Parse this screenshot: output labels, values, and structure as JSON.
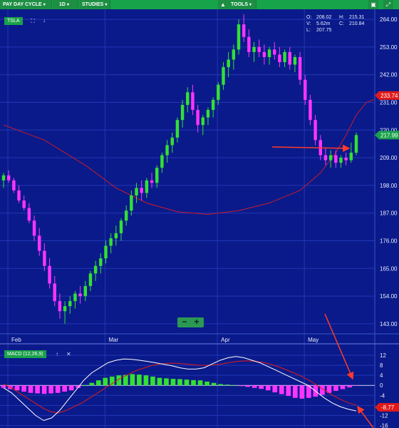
{
  "toolbar": {
    "pay_day_cycle": "PAY DAY CYCLE",
    "interval": "1D",
    "studies": "STUDIES",
    "tools": "TOOLS"
  },
  "ticker": "TSLA",
  "macd_label": "MACD (12,26,9)",
  "ohlc": {
    "o_label": "O:",
    "o": "208.02",
    "h_label": "H:",
    "h": "215.31",
    "v_label": "V:",
    "v": "5.62m",
    "c_label": "C:",
    "c": "210.84",
    "l_label": "L:",
    "l": "207.75"
  },
  "colors": {
    "background": "#0a1a8a",
    "up": "#33e033",
    "down": "#ff33ff",
    "ma": "#cc1a2a",
    "macd_signal": "#e01a1a",
    "macd_line": "#ffffff",
    "arrow": "#ff3a2a",
    "toolbar": "#17a34a"
  },
  "chart_data": [
    {
      "type": "candlestick",
      "title": "TSLA",
      "x_labels": [
        "Feb",
        "Mar",
        "Apr",
        "May"
      ],
      "yticks": [
        "264.00",
        "253.00",
        "242.00",
        "231.00",
        "220.00",
        "209.00",
        "198.00",
        "187.00",
        "176.00",
        "165.00",
        "154.00",
        "143.00"
      ],
      "ylim": [
        139,
        268
      ],
      "price_tags": [
        {
          "label": "233.74",
          "color": "#e01a1a"
        },
        {
          "label": "217.99",
          "color": "#1aa14a"
        }
      ],
      "ohlc": [
        [
          200,
          203,
          197,
          202
        ],
        [
          202,
          204,
          199,
          200
        ],
        [
          200,
          201,
          195,
          196
        ],
        [
          196,
          198,
          191,
          192
        ],
        [
          192,
          194,
          188,
          189
        ],
        [
          189,
          191,
          183,
          184
        ],
        [
          184,
          186,
          176,
          178
        ],
        [
          178,
          181,
          170,
          172
        ],
        [
          172,
          175,
          164,
          166
        ],
        [
          166,
          169,
          157,
          159
        ],
        [
          159,
          162,
          150,
          152
        ],
        [
          152,
          155,
          145,
          148
        ],
        [
          148,
          152,
          143,
          150
        ],
        [
          150,
          154,
          147,
          152
        ],
        [
          152,
          156,
          149,
          155
        ],
        [
          155,
          158,
          151,
          154
        ],
        [
          154,
          160,
          152,
          158
        ],
        [
          158,
          164,
          156,
          163
        ],
        [
          163,
          168,
          160,
          166
        ],
        [
          166,
          171,
          163,
          169
        ],
        [
          169,
          176,
          167,
          174
        ],
        [
          174,
          179,
          171,
          177
        ],
        [
          177,
          182,
          174,
          179
        ],
        [
          179,
          185,
          176,
          184
        ],
        [
          184,
          190,
          182,
          188
        ],
        [
          188,
          196,
          186,
          194
        ],
        [
          194,
          199,
          191,
          197
        ],
        [
          197,
          200,
          192,
          195
        ],
        [
          195,
          201,
          193,
          200
        ],
        [
          200,
          203,
          197,
          199
        ],
        [
          199,
          206,
          197,
          205
        ],
        [
          205,
          211,
          203,
          210
        ],
        [
          210,
          216,
          207,
          214
        ],
        [
          214,
          219,
          211,
          217
        ],
        [
          217,
          225,
          215,
          224
        ],
        [
          224,
          232,
          221,
          230
        ],
        [
          230,
          237,
          227,
          235
        ],
        [
          235,
          238,
          226,
          228
        ],
        [
          228,
          230,
          219,
          222
        ],
        [
          222,
          226,
          218,
          225
        ],
        [
          225,
          229,
          222,
          228
        ],
        [
          228,
          233,
          225,
          232
        ],
        [
          232,
          239,
          230,
          238
        ],
        [
          238,
          247,
          236,
          245
        ],
        [
          245,
          251,
          241,
          248
        ],
        [
          248,
          254,
          244,
          252
        ],
        [
          252,
          264,
          250,
          262
        ],
        [
          262,
          266,
          255,
          257
        ],
        [
          257,
          260,
          249,
          251
        ],
        [
          251,
          255,
          247,
          253
        ],
        [
          253,
          256,
          249,
          251
        ],
        [
          251,
          254,
          246,
          249
        ],
        [
          249,
          253,
          246,
          252
        ],
        [
          252,
          255,
          248,
          250
        ],
        [
          250,
          253,
          245,
          247
        ],
        [
          247,
          252,
          245,
          251
        ],
        [
          251,
          253,
          244,
          246
        ],
        [
          246,
          250,
          243,
          249
        ],
        [
          249,
          251,
          238,
          240
        ],
        [
          240,
          242,
          230,
          232
        ],
        [
          232,
          234,
          222,
          224
        ],
        [
          224,
          226,
          214,
          216
        ],
        [
          216,
          218,
          208,
          210
        ],
        [
          210,
          213,
          206,
          208
        ],
        [
          208,
          212,
          205,
          210
        ],
        [
          210,
          212,
          205,
          207
        ],
        [
          207,
          210,
          205,
          209
        ],
        [
          209,
          211,
          206,
          208
        ],
        [
          208,
          215,
          207,
          211
        ],
        [
          211,
          219,
          210,
          218
        ]
      ],
      "moving_average": [
        [
          0,
          222
        ],
        [
          8,
          216
        ],
        [
          16,
          206
        ],
        [
          22,
          197
        ],
        [
          28,
          191
        ],
        [
          34,
          187.5
        ],
        [
          40,
          186.5
        ],
        [
          46,
          188
        ],
        [
          52,
          191
        ],
        [
          58,
          196
        ],
        [
          62,
          203
        ],
        [
          65,
          211
        ],
        [
          67,
          218
        ],
        [
          69,
          226
        ],
        [
          71,
          231
        ],
        [
          73,
          232.5
        ],
        [
          77,
          233.74
        ]
      ]
    },
    {
      "type": "bar",
      "title": "MACD (12,26,9)",
      "yticks": [
        "12",
        "8",
        "4",
        "0",
        "-4",
        "-8",
        "-12",
        "-16"
      ],
      "ylim": [
        -17,
        14
      ],
      "value_tag": "-8.77",
      "histogram": [
        -1,
        -1.5,
        -2,
        -2.5,
        -3,
        -3.2,
        -3.4,
        -3.2,
        -3,
        -2.5,
        -2,
        -1,
        0,
        1,
        2,
        3,
        3.5,
        4,
        4.2,
        4.5,
        4.3,
        4,
        3.5,
        3,
        2.8,
        2.6,
        2.5,
        2.3,
        2.1,
        2,
        1.5,
        1,
        0.5,
        0.3,
        0,
        -0.3,
        -0.6,
        -1,
        -1.4,
        -2,
        -2.8,
        -3.5,
        -4.2,
        -5,
        -5.3,
        -5,
        -4.5,
        -3.8,
        -3,
        -2.2,
        -1.5,
        -0.8,
        -0.2
      ],
      "macd": [
        -1,
        -3,
        -6,
        -9,
        -12,
        -14,
        -13,
        -10,
        -6,
        -2,
        2,
        5,
        7,
        9,
        10,
        10.5,
        10.4,
        10,
        9.5,
        9,
        8.4,
        7.8,
        7,
        6.5,
        6.5,
        7,
        8.5,
        10,
        11,
        11.5,
        11,
        10,
        9,
        7.5,
        6,
        4.5,
        3,
        1.5,
        0,
        -2.5,
        -5,
        -7,
        -8.5,
        -9.5,
        -10.2
      ],
      "signal": [
        0.5,
        -1,
        -3,
        -5,
        -7,
        -9,
        -10.5,
        -11,
        -10,
        -8.5,
        -7,
        -5,
        -3,
        -1,
        1,
        3,
        4.5,
        6,
        7,
        8,
        8.5,
        8.8,
        8.8,
        8.6,
        8.3,
        8,
        8,
        8.2,
        8.6,
        9.2,
        9.6,
        9.8,
        9.6,
        9.2,
        8.5,
        7.5,
        6.3,
        5,
        3.6,
        2,
        0,
        -2,
        -4,
        -5.6,
        -7,
        -7.8
      ]
    }
  ]
}
